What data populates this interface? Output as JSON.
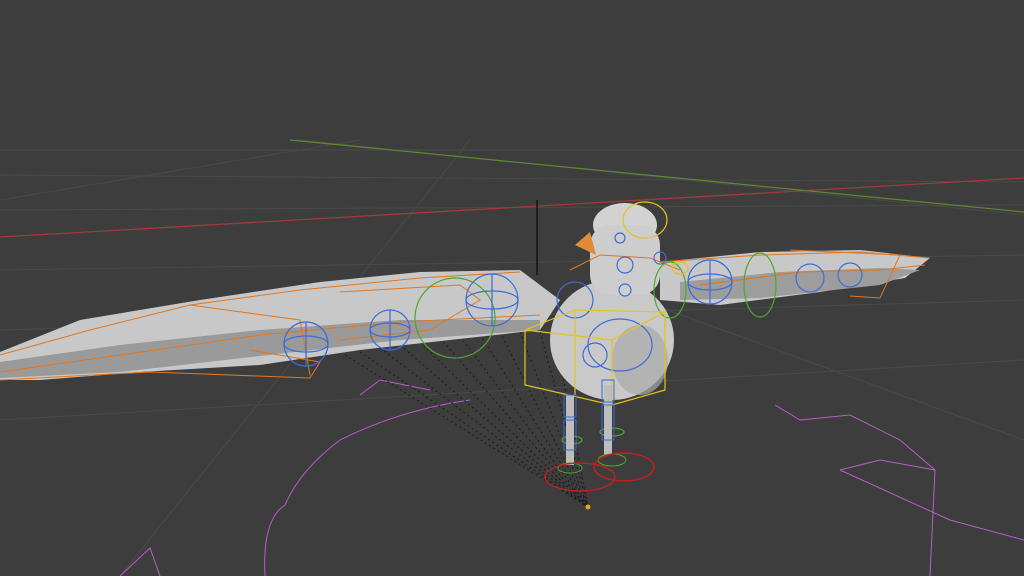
{
  "viewport": {
    "background": "#3d3d3d",
    "grid_color": "#4a4a4a",
    "axis_x_color": "#a23a3a",
    "axis_y_color": "#5d8a30"
  },
  "rig": {
    "mesh_color": "#c8c8c8",
    "mesh_shadow_color": "#8a8a8a",
    "orange_controls": "#e0771f",
    "blue_controls": "#3c6cd9",
    "green_controls": "#4ea82a",
    "yellow_controls": "#e3c41c",
    "red_controls": "#c42020",
    "purple_outline": "#b85cc8"
  }
}
